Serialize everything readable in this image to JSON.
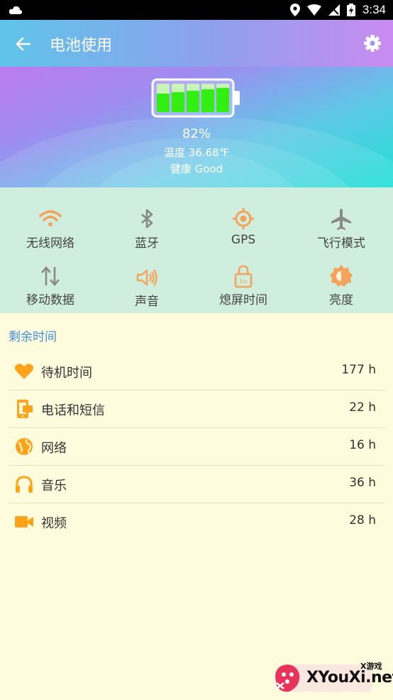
{
  "status_bar": {
    "time": "3:34"
  },
  "header": {
    "title": "电池使用"
  },
  "battery": {
    "percent_text": "82%",
    "level": 0.82,
    "temperature": "温度 36.68℉",
    "health": "健康 Good"
  },
  "toggles": [
    {
      "label": "无线网络",
      "icon": "wifi-icon",
      "color": "#f5a35c"
    },
    {
      "label": "蓝牙",
      "icon": "bluetooth-icon",
      "color": "#8a8a8a"
    },
    {
      "label": "GPS",
      "icon": "gps-icon",
      "color": "#f5a35c"
    },
    {
      "label": "飞行模式",
      "icon": "airplane-icon",
      "color": "#8a8a8a"
    },
    {
      "label": "移动数据",
      "icon": "mobile-data-icon",
      "color": "#8a8a8a"
    },
    {
      "label": "声音",
      "icon": "sound-icon",
      "color": "#f5a35c"
    },
    {
      "label": "熄屏时间",
      "icon": "screen-timeout-icon",
      "color": "#f5a35c",
      "badge": "1m"
    },
    {
      "label": "亮度",
      "icon": "brightness-icon",
      "color": "#f5a35c"
    }
  ],
  "remaining": {
    "title": "剩余时间",
    "items": [
      {
        "label": "待机时间",
        "value": "177 h",
        "icon": "heart-icon"
      },
      {
        "label": "电话和短信",
        "value": "22 h",
        "icon": "phone-message-icon"
      },
      {
        "label": "网络",
        "value": "16 h",
        "icon": "globe-icon"
      },
      {
        "label": "音乐",
        "value": "36 h",
        "icon": "headphones-icon"
      },
      {
        "label": "视频",
        "value": "28 h",
        "icon": "video-camera-icon"
      }
    ]
  },
  "colors": {
    "accent": "#ffa31a",
    "section_title": "#3d8fdc",
    "battery_fill": "#33ee11"
  },
  "watermark": {
    "small": "X游戏",
    "text": "XYouXi.net"
  }
}
